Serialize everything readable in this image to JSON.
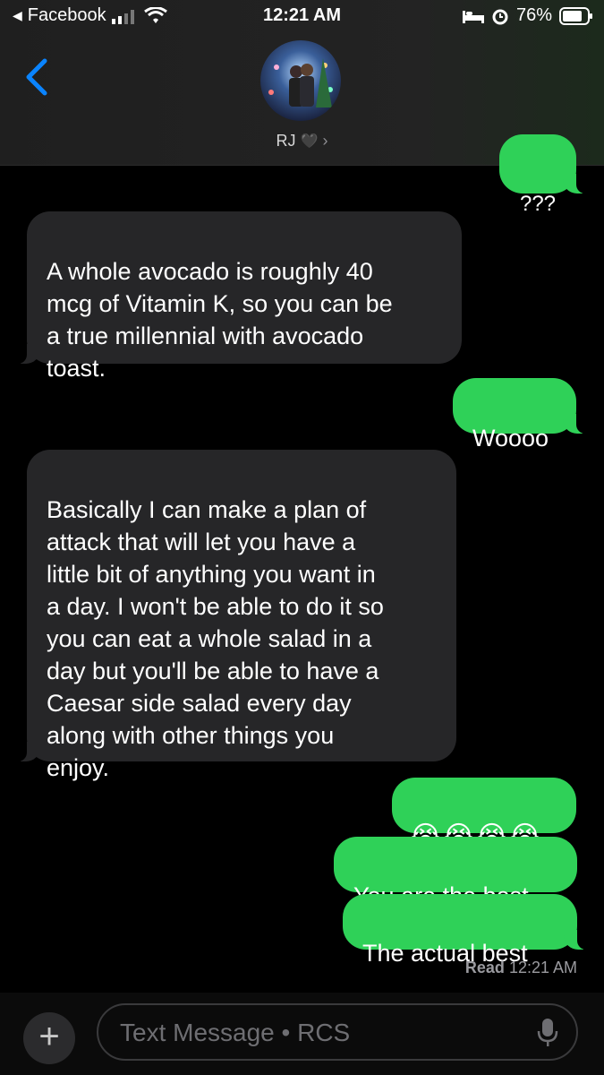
{
  "status_bar": {
    "back_app": "Facebook",
    "time": "12:21 AM",
    "battery": "76%"
  },
  "contact": {
    "name": "RJ",
    "emoji": "🖤"
  },
  "messages": [
    {
      "side": "out",
      "text": "???"
    },
    {
      "side": "in",
      "text": "A whole avocado is roughly 40\nmcg of Vitamin K, so you can be\na true millennial with avocado\ntoast."
    },
    {
      "side": "out",
      "text": "Woooo"
    },
    {
      "side": "in",
      "text": "Basically I can make a plan of\nattack that will let you have a\nlittle bit of anything you want in\na day. I won't be able to do it so\nyou can eat a whole salad in a\nday but you'll be able to have a\nCaesar side salad every day\nalong with other things you\nenjoy."
    },
    {
      "side": "out",
      "text": "😭😭😭😭"
    },
    {
      "side": "out",
      "text": "You are the best"
    },
    {
      "side": "out",
      "text": "The actual best"
    }
  ],
  "read_receipt": {
    "label": "Read",
    "time": "12:21 AM"
  },
  "composer": {
    "placeholder": "Text Message • RCS"
  },
  "colors": {
    "outgoing_bubble": "#2fd158",
    "incoming_bubble": "#262628",
    "accent_blue": "#0a84ff"
  }
}
